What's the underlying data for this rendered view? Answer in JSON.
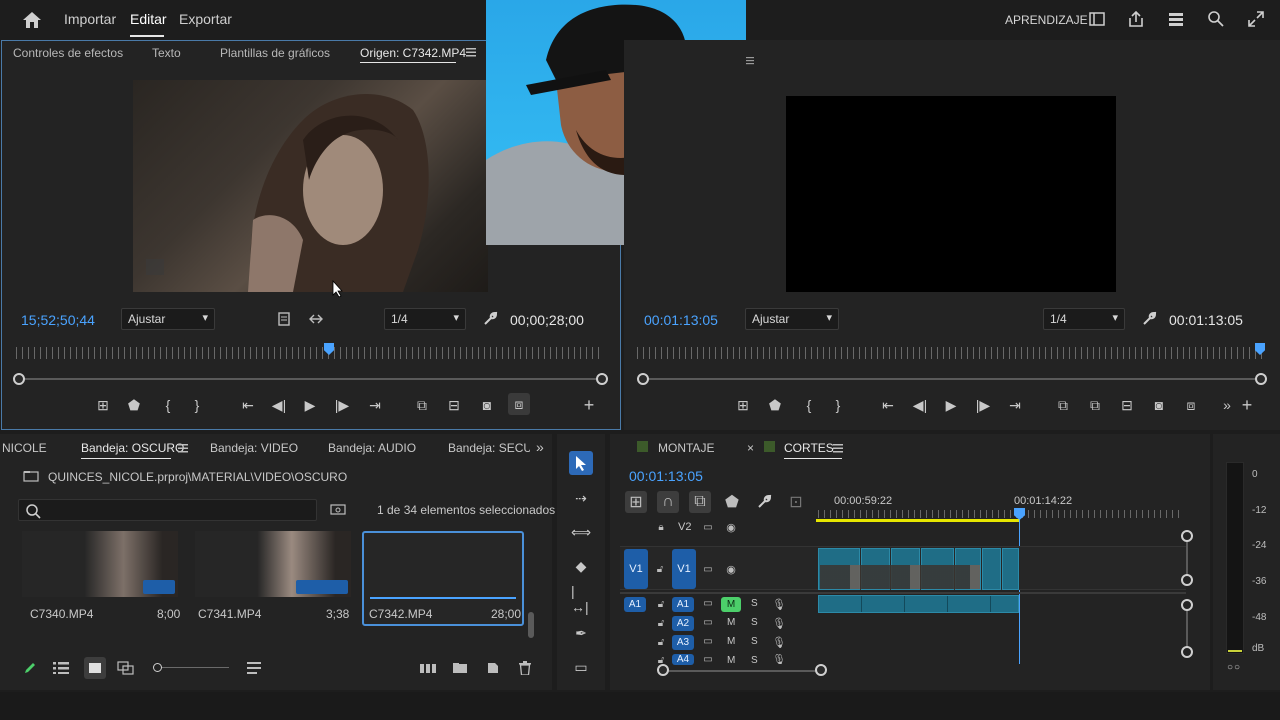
{
  "topbar": {
    "home_icon": "home-icon",
    "menu": [
      "Importar",
      "Editar",
      "Exportar"
    ],
    "active": "Editar",
    "right_label": "APRENDIZAJE"
  },
  "source_panel": {
    "tabs": [
      "Controles de efectos",
      "Texto",
      "Plantillas de gráficos",
      "Origen: C7342.MP4"
    ],
    "timecode_left": "15;52;50;44",
    "fit": "Ajustar",
    "resolution": "1/4",
    "timecode_right": "00;00;28;00"
  },
  "program_panel": {
    "timecode_left": "00:01:13:05",
    "fit": "Ajustar",
    "resolution": "1/4",
    "timecode_right": "00:01:13:05"
  },
  "project_panel": {
    "tabs": [
      "NICOLE",
      "Bandeja: OSCURO",
      "Bandeja: VIDEO",
      "Bandeja: AUDIO",
      "Bandeja: SECUEN"
    ],
    "path": "QUINCES_NICOLE.prproj\\MATERIAL\\VIDEO\\OSCURO",
    "search_placeholder": "",
    "selection_count": "1 de 34 elementos seleccionados",
    "clips": [
      {
        "name": "C7340.MP4",
        "duration": "8;00"
      },
      {
        "name": "C7341.MP4",
        "duration": "3;38"
      },
      {
        "name": "C7342.MP4",
        "duration": "28;00"
      }
    ]
  },
  "timeline": {
    "tabs": [
      "MONTAJE",
      "CORTES"
    ],
    "timecode": "00:01:13:05",
    "ruler_labels": [
      "00:00:59:22",
      "00:01:14:22"
    ],
    "video_tracks": [
      "V2",
      "V1"
    ],
    "audio_tracks": [
      "A1",
      "A2",
      "A3",
      "A4"
    ],
    "track_toggles": [
      "M",
      "S"
    ]
  },
  "audio_meter": {
    "labels": [
      "0",
      "-12",
      "-24",
      "-36",
      "-48",
      "dB"
    ],
    "solo_labels": "S S"
  }
}
